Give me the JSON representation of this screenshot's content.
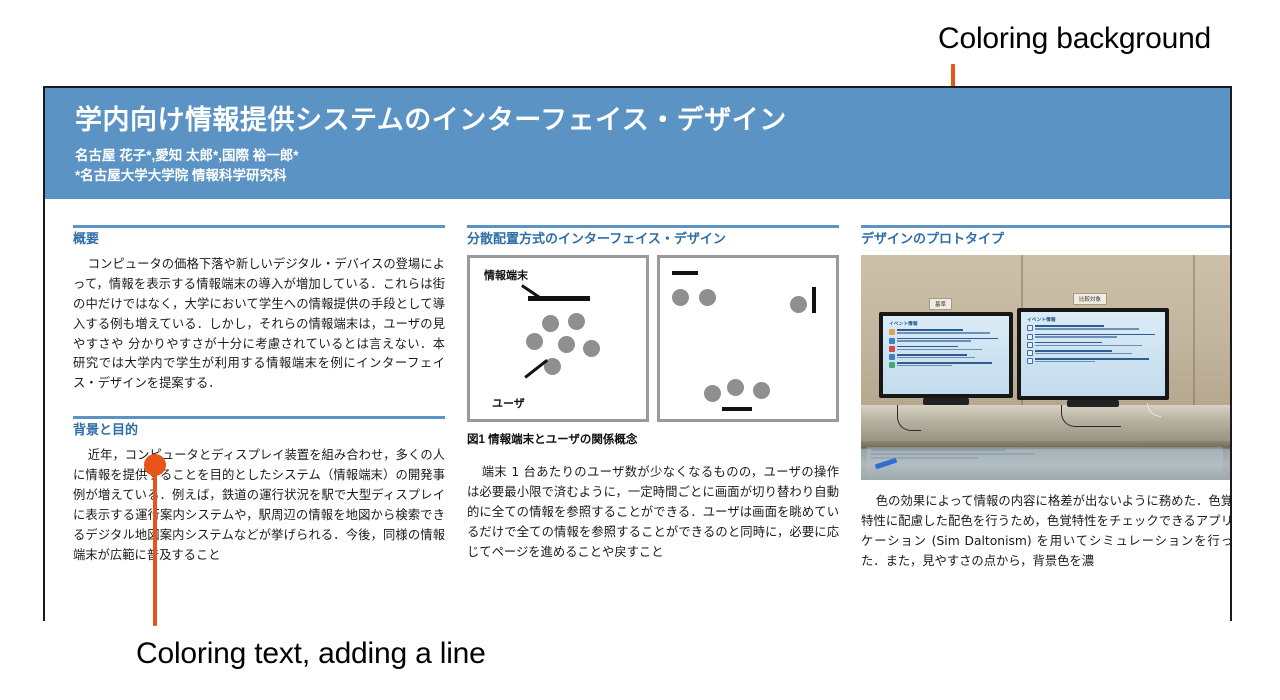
{
  "annotations": {
    "top": {
      "label": "Coloring background",
      "color": "#E8541A"
    },
    "bottom": {
      "label": "Coloring text, adding a line",
      "color": "#E8541A"
    }
  },
  "poster": {
    "banner": {
      "background_color": "#5B93C5",
      "title": "学内向け情報提供システムのインターフェイス・デザイン",
      "authors": "名古屋 花子*,愛知 太郎*,国際 裕一郎*",
      "affiliation": "*名古屋大学大学院 情報科学研究科"
    },
    "accent_color": "#5B93C5",
    "heading_color": "#2E6DA8",
    "columns": [
      {
        "sections": [
          {
            "heading": "概要",
            "body": "コンピュータの価格下落や新しいデジタル・デバイスの登場によって，情報を表示する情報端末の導入が増加している．これらは街の中だけではなく，大学において学生への情報提供の手段として導入する例も増えている．しかし，それらの情報端末は，ユーザの見やすさや 分かりやすさが十分に考慮されているとは言えない．本研究では大学内で学生が利用する情報端末を例にインターフェイス・デザインを提案する．"
          },
          {
            "heading": "背景と目的",
            "body": "近年，コンピュータとディスプレイ装置を組み合わせ，多くの人に情報を提供することを目的としたシステム（情報端末）の開発事例が増えている．例えば，鉄道の運行状況を駅で大型ディスプレイに表示する運行案内システムや，駅周辺の情報を地図から検索できるデジタル地図案内システムなどが挙げられる．今後，同様の情報端末が広範に普及すること"
          }
        ]
      },
      {
        "sections": [
          {
            "heading": "分散配置方式のインターフェイス・デザイン",
            "figure": {
              "caption": "図1 情報端末とユーザの関係概念",
              "label_terminal": "情報端末",
              "label_user": "ユーザ"
            },
            "body": "端末 1 台あたりのユーザ数が少なくなるものの，ユーザの操作は必要最小限で済むように，一定時間ごとに画面が切り替わり自動的に全ての情報を参照することができる．ユーザは画面を眺めているだけで全ての情報を参照することができるのと同時に，必要に応じてページを進めることや戻すこと"
          }
        ]
      },
      {
        "sections": [
          {
            "heading": "デザインのプロトタイプ",
            "photo": {
              "tv_left_label": "基準",
              "tv_right_label": "比較対象",
              "screen_title": "イベント情報"
            },
            "body": "色の効果によって情報の内容に格差が出ないように務めた．色覚特性に配慮した配色を行うため，色覚特性をチェックできるアプリケーション (Sim Daltonism) を用いてシミュレーションを行った．また，見やすさの点から，背景色を濃"
          }
        ]
      }
    ]
  }
}
